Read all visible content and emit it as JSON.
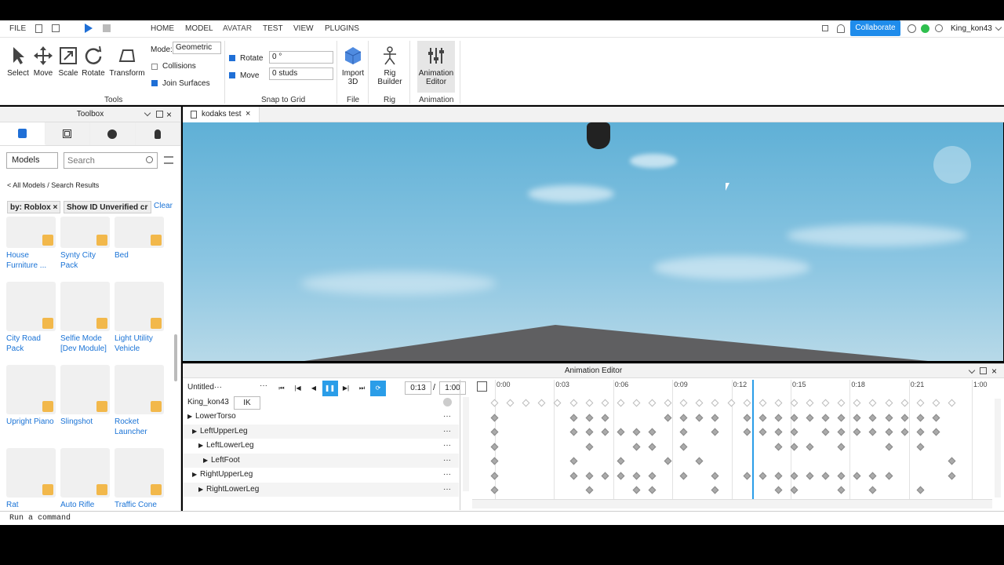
{
  "menu": [
    "FILE",
    "HOME",
    "MODEL",
    "AVATAR",
    "TEST",
    "VIEW",
    "PLUGINS"
  ],
  "header": {
    "collaborate": "Collaborate",
    "user": "King_kon43"
  },
  "tools": {
    "select": "Select",
    "move": "Move",
    "scale": "Scale",
    "rotate": "Rotate",
    "transform": "Transform",
    "group": "Tools"
  },
  "mode": {
    "label": "Mode:",
    "value": "Geometric",
    "collisions": "Collisions",
    "join": "Join Surfaces"
  },
  "snap": {
    "rotate_label": "Rotate",
    "rotate_value": "0 °",
    "move_label": "Move",
    "move_value": "0 studs",
    "group": "Snap to Grid"
  },
  "file": {
    "import": "Import",
    "import2": "3D",
    "group": "File"
  },
  "rig": {
    "label1": "Rig",
    "label2": "Builder",
    "group": "Rig"
  },
  "animation": {
    "label1": "Animation",
    "label2": "Editor",
    "group": "Animation"
  },
  "toolbox": {
    "title": "Toolbox",
    "category": "Models",
    "search_placeholder": "Search",
    "breadcrumb": "< All Models / Search Results",
    "filter1": "by: Roblox ×",
    "filter2": "Show ID Unverified cr",
    "clear": "Clear",
    "items": [
      {
        "name": "House Furniture ..."
      },
      {
        "name": "Synty City Pack"
      },
      {
        "name": "Bed"
      },
      {
        "name": "City Road Pack"
      },
      {
        "name": "Selfie Mode [Dev Module]"
      },
      {
        "name": "Light Utility Vehicle"
      },
      {
        "name": "Upright Piano"
      },
      {
        "name": "Slingshot"
      },
      {
        "name": "Rocket Launcher"
      },
      {
        "name": "Rat"
      },
      {
        "name": "Auto Rifle"
      },
      {
        "name": "Traffic Cone"
      }
    ]
  },
  "doc_tab": "kodaks test",
  "anim_editor": {
    "title": "Animation Editor",
    "anim_name": "Untitled···",
    "time_current": "0:13",
    "time_total": "1:00",
    "rig": "King_kon43",
    "ik": "IK",
    "tracks": [
      "LowerTorso",
      "LeftUpperLeg",
      "LeftLowerLeg",
      "LeftFoot",
      "RightUpperLeg",
      "RightLowerLeg"
    ],
    "ticks": [
      "0:00",
      "0:03",
      "0:06",
      "0:09",
      "0:12",
      "0:15",
      "0:18",
      "0:21",
      "1:00"
    ]
  },
  "command": "Run a command"
}
